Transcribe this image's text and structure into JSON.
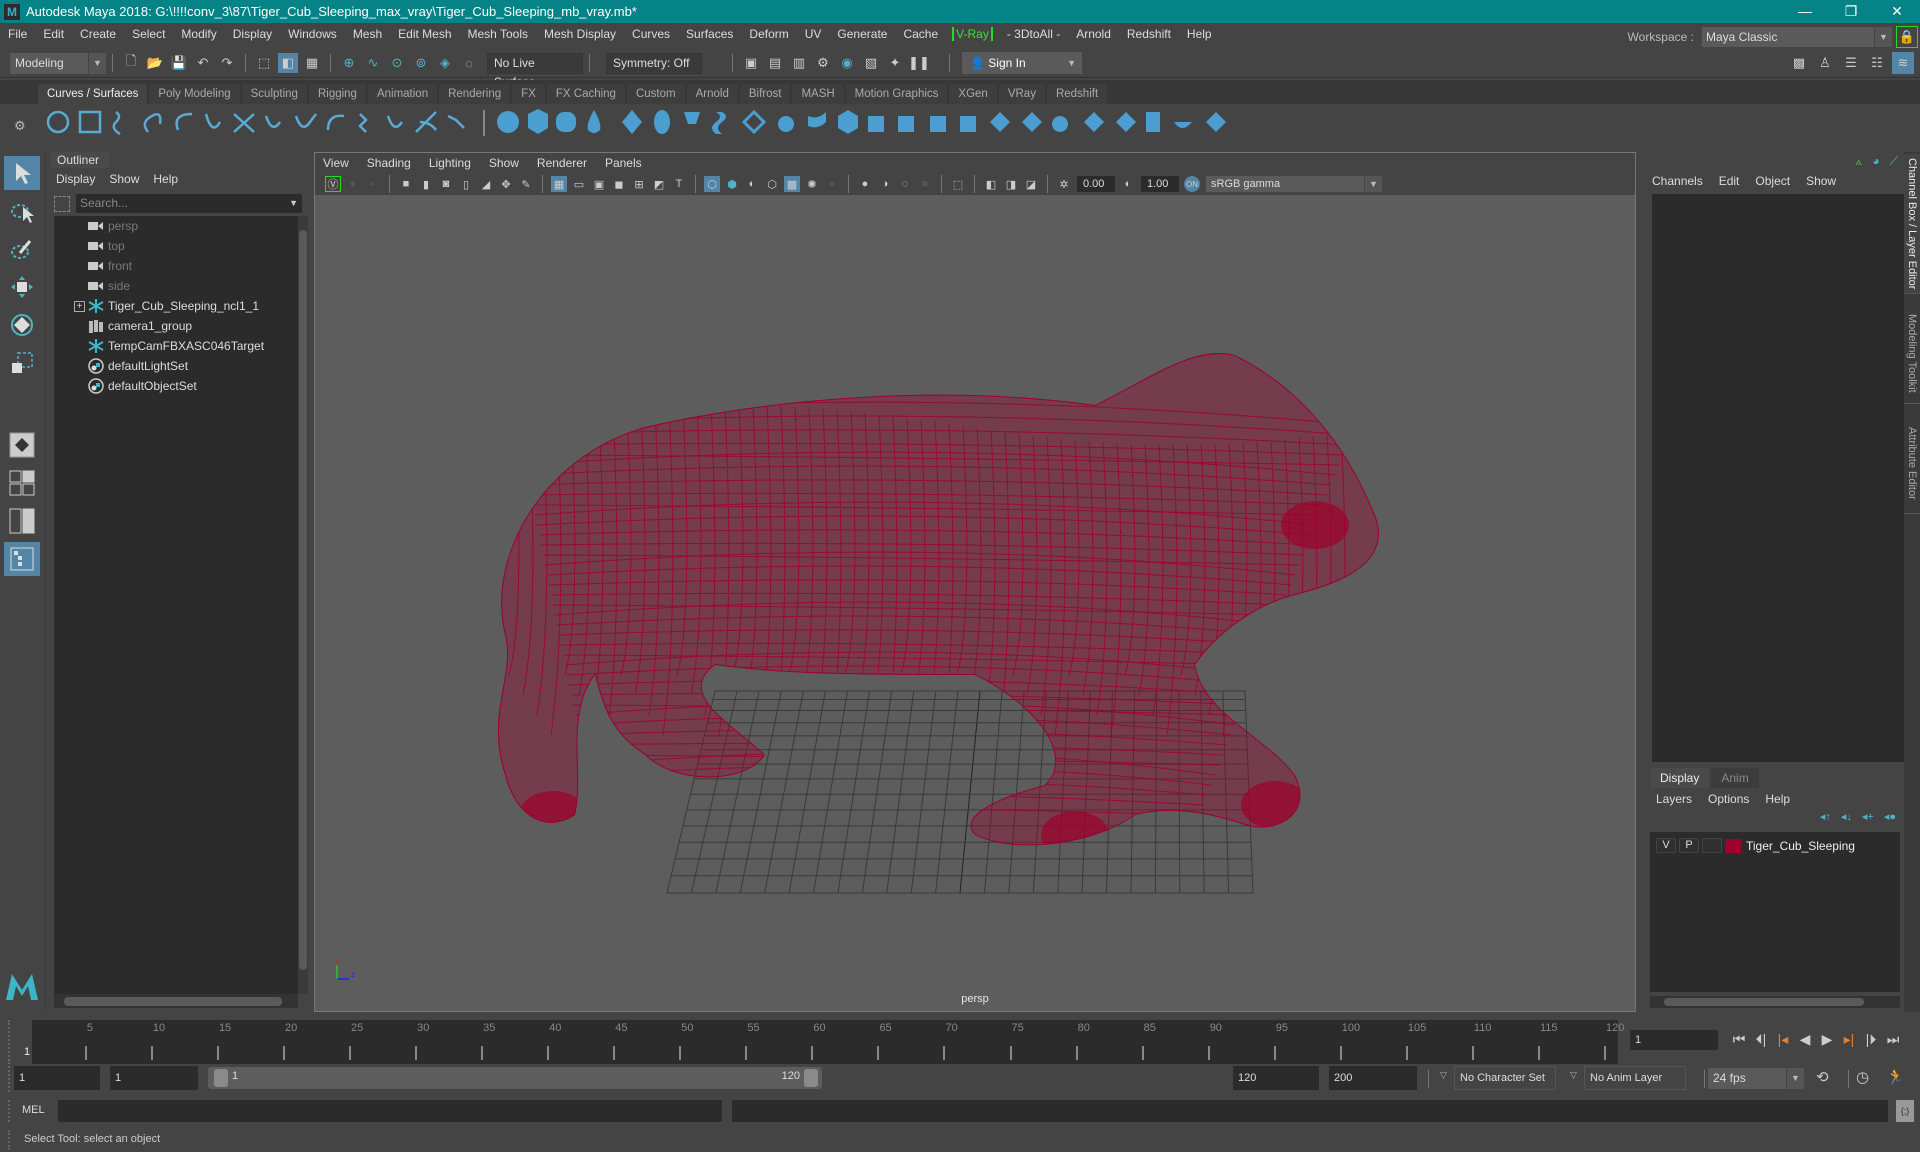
{
  "titlebar": {
    "title": "Autodesk Maya 2018: G:\\!!!!conv_3\\87\\Tiger_Cub_Sleeping_max_vray\\Tiger_Cub_Sleeping_mb_vray.mb*",
    "logo": "M",
    "minimize": "—",
    "maximize": "❐",
    "close": "✕"
  },
  "menubar": {
    "items": [
      "File",
      "Edit",
      "Create",
      "Select",
      "Modify",
      "Display",
      "Windows",
      "Mesh",
      "Edit Mesh",
      "Mesh Tools",
      "Mesh Display",
      "Curves",
      "Surfaces",
      "Deform",
      "UV",
      "Generate",
      "Cache"
    ],
    "vray": "V-Ray",
    "items2": [
      "- 3DtoAll -",
      "Arnold",
      "Redshift",
      "Help"
    ]
  },
  "workspace": {
    "label": "Workspace :",
    "value": "Maya Classic",
    "lock_icon": "lock-icon"
  },
  "statusline": {
    "mode": "Modeling",
    "live_surface": "No Live Surface",
    "symmetry": "Symmetry: Off",
    "sign_in": "Sign In"
  },
  "shelf": {
    "tabs": [
      "Curves / Surfaces",
      "Poly Modeling",
      "Sculpting",
      "Rigging",
      "Animation",
      "Rendering",
      "FX",
      "FX Caching",
      "Custom",
      "Arnold",
      "Bifrost",
      "MASH",
      "Motion Graphics",
      "XGen",
      "VRay",
      "Redshift"
    ],
    "active_tab": "Curves / Surfaces"
  },
  "outliner": {
    "title": "Outliner",
    "menus": [
      "Display",
      "Show",
      "Help"
    ],
    "search_placeholder": "Search...",
    "items": [
      {
        "label": "persp",
        "icon": "camera-icon",
        "dim": true
      },
      {
        "label": "top",
        "icon": "camera-icon",
        "dim": true
      },
      {
        "label": "front",
        "icon": "camera-icon",
        "dim": true
      },
      {
        "label": "side",
        "icon": "camera-icon",
        "dim": true
      },
      {
        "label": "Tiger_Cub_Sleeping_ncl1_1",
        "icon": "joint-icon",
        "expandable": true
      },
      {
        "label": "camera1_group",
        "icon": "group-icon"
      },
      {
        "label": "TempCamFBXASC046Target",
        "icon": "joint-icon"
      },
      {
        "label": "defaultLightSet",
        "icon": "set-icon"
      },
      {
        "label": "defaultObjectSet",
        "icon": "set-icon"
      }
    ]
  },
  "viewport": {
    "menus": [
      "View",
      "Shading",
      "Lighting",
      "Show",
      "Renderer",
      "Panels"
    ],
    "exposure": "0.00",
    "gamma": "1.00",
    "color_space": "sRGB gamma",
    "camera_label": "persp",
    "wire_color": "#a0002e"
  },
  "channelbox": {
    "menus": [
      "Channels",
      "Edit",
      "Object",
      "Show"
    ],
    "side_tabs": [
      "Channel Box / Layer Editor",
      "Modeling Toolkit",
      "Attribute Editor"
    ]
  },
  "layer_editor": {
    "tabs": [
      "Display",
      "Anim"
    ],
    "menus": [
      "Layers",
      "Options",
      "Help"
    ],
    "layers": [
      {
        "v": "V",
        "p": "P",
        "color": "#a0002e",
        "name": "Tiger_Cub_Sleeping"
      }
    ]
  },
  "timeline": {
    "ticks": [
      5,
      10,
      15,
      20,
      25,
      30,
      35,
      40,
      45,
      50,
      55,
      60,
      65,
      70,
      75,
      80,
      85,
      90,
      95,
      100,
      105,
      110,
      115,
      120
    ],
    "start": 1,
    "end": 120,
    "current_frame": "1",
    "current_frame_label": "1"
  },
  "range": {
    "start_field": "1",
    "anim_start": "1",
    "range_start": "1",
    "range_end": "120",
    "playback_end": "120",
    "anim_end": "200",
    "character_set": "No Character Set",
    "anim_layer": "No Anim Layer",
    "fps": "24 fps"
  },
  "cmdline": {
    "label": "MEL"
  },
  "helpline": {
    "text": "Select Tool: select an object"
  }
}
